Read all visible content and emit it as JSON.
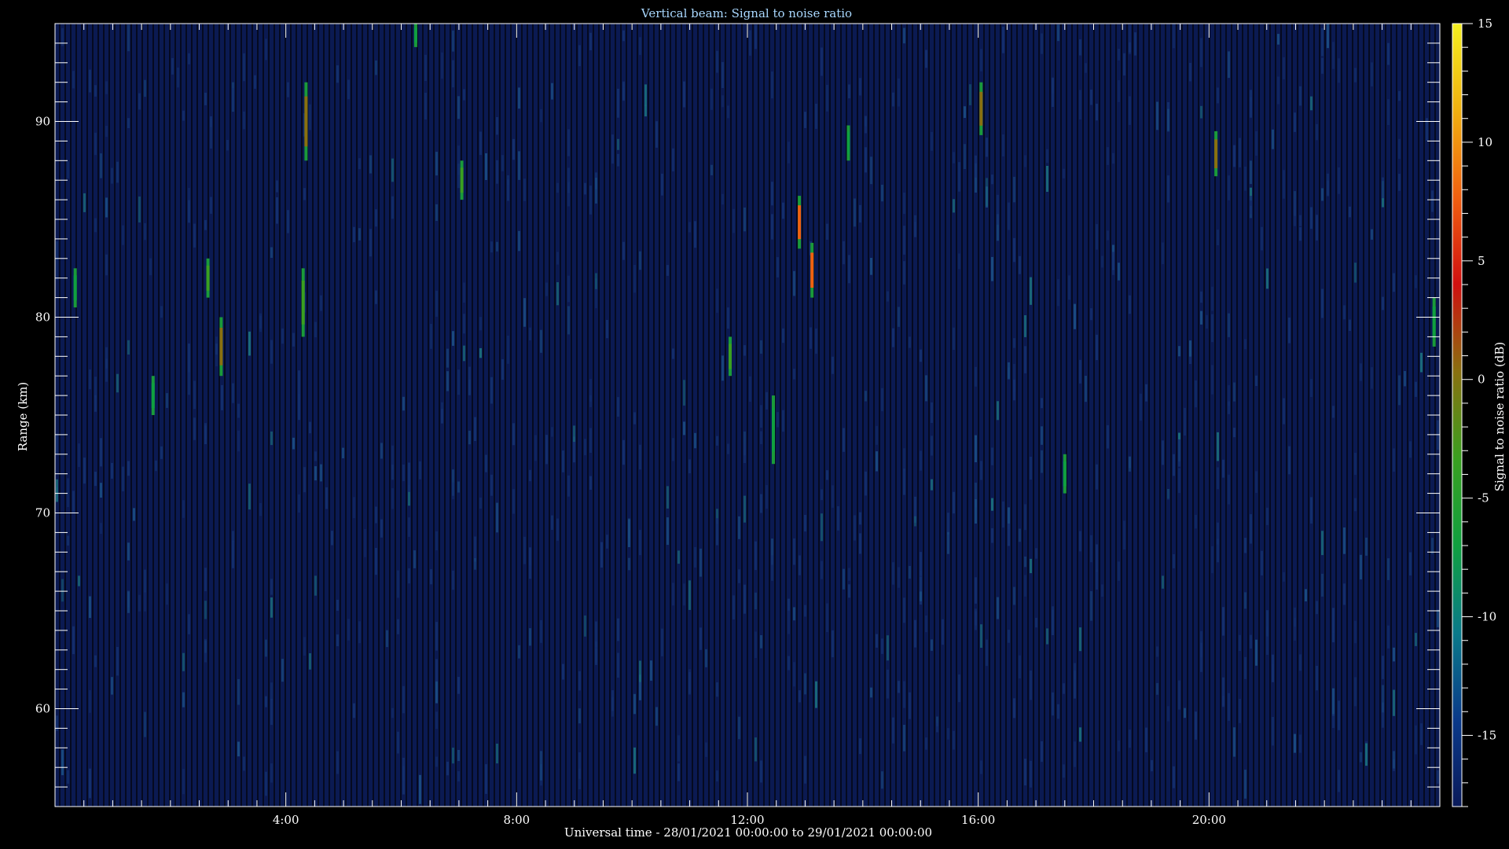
{
  "chart_data": {
    "type": "heatmap",
    "title": "Vertical beam: Signal to noise ratio",
    "xlabel": "Universal time - 28/01/2021 00:00:00 to 29/01/2021 00:00:00",
    "ylabel": "Range (km)",
    "colorbar_label": "Signal to noise ratio (dB)",
    "xlim_hours": [
      0,
      24
    ],
    "ylim_km": [
      55,
      95
    ],
    "clim_db": [
      -18,
      15
    ],
    "x_ticks": [
      {
        "h": 4,
        "label": "4:00"
      },
      {
        "h": 8,
        "label": "8:00"
      },
      {
        "h": 12,
        "label": "12:00"
      },
      {
        "h": 16,
        "label": "16:00"
      },
      {
        "h": 20,
        "label": "20:00"
      }
    ],
    "y_ticks": [
      {
        "km": 60,
        "label": "60"
      },
      {
        "km": 70,
        "label": "70"
      },
      {
        "km": 80,
        "label": "80"
      },
      {
        "km": 90,
        "label": "90"
      }
    ],
    "colorbar_ticks": [
      {
        "db": 15,
        "label": "15"
      },
      {
        "db": 10,
        "label": "10"
      },
      {
        "db": 5,
        "label": "5"
      },
      {
        "db": 0,
        "label": "0"
      },
      {
        "db": -5,
        "label": "-5"
      },
      {
        "db": -10,
        "label": "-10"
      },
      {
        "db": -15,
        "label": "-15"
      }
    ],
    "background_db": -17,
    "colormap": [
      "#0a1a5a",
      "#0a3a8a",
      "#0a7a8a",
      "#10a040",
      "#3aa020",
      "#8a7010",
      "#d01010",
      "#f06010",
      "#f0b010",
      "#f5f020"
    ],
    "echoes": [
      {
        "t": 0.35,
        "r0": 80.5,
        "r1": 82.5,
        "db": -6
      },
      {
        "t": 1.7,
        "r0": 75,
        "r1": 77,
        "db": -7
      },
      {
        "t": 2.65,
        "r0": 81,
        "r1": 83,
        "db": -4
      },
      {
        "t": 2.88,
        "r0": 77,
        "r1": 80,
        "db": 1
      },
      {
        "t": 4.3,
        "r0": 79,
        "r1": 82.5,
        "db": -2
      },
      {
        "t": 4.35,
        "r0": 88,
        "r1": 92,
        "db": 2
      },
      {
        "t": 7.05,
        "r0": 86,
        "r1": 88,
        "db": -5
      },
      {
        "t": 6.25,
        "r0": 93.8,
        "r1": 95,
        "db": -7
      },
      {
        "t": 11.7,
        "r0": 77,
        "r1": 79,
        "db": -5
      },
      {
        "t": 12.45,
        "r0": 72.5,
        "r1": 76,
        "db": -7
      },
      {
        "t": 12.9,
        "r0": 83.5,
        "r1": 86.2,
        "db": 6
      },
      {
        "t": 13.12,
        "r0": 81,
        "r1": 83.8,
        "db": 9
      },
      {
        "t": 13.75,
        "r0": 88,
        "r1": 89.8,
        "db": -6
      },
      {
        "t": 16.05,
        "r0": 89.3,
        "r1": 92,
        "db": 1
      },
      {
        "t": 17.5,
        "r0": 71,
        "r1": 73,
        "db": -6
      },
      {
        "t": 20.12,
        "r0": 87.2,
        "r1": 89.5,
        "db": 1
      },
      {
        "t": 23.9,
        "r0": 78.5,
        "r1": 81,
        "db": -8
      }
    ]
  }
}
